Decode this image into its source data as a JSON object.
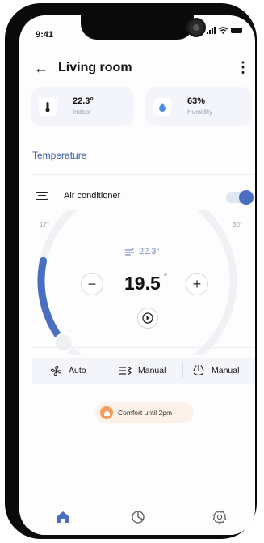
{
  "status": {
    "time": "9:41"
  },
  "header": {
    "title": "Living room"
  },
  "cards": {
    "indoor": {
      "value": "22.3°",
      "label": "Indoor"
    },
    "humidity": {
      "value": "63%",
      "label": "Humidity"
    }
  },
  "section": {
    "title": "Temperature"
  },
  "ac": {
    "label": "Air conditioner",
    "on": true
  },
  "dial": {
    "min_label": "17°",
    "max_label": "30°",
    "current": "22.3°",
    "setpoint": "19.5",
    "setpoint_unit": "°",
    "min_value": 17,
    "max_value": 30,
    "setpoint_value": 19.5
  },
  "modes": [
    {
      "icon": "fan-icon",
      "label": "Auto"
    },
    {
      "icon": "airflow-icon",
      "label": "Manual"
    },
    {
      "icon": "swing-icon",
      "label": "Manual"
    }
  ],
  "comfort": {
    "label": "Comfort until 2pm"
  },
  "colors": {
    "accent": "#4a6fc1",
    "orange": "#f29c5e",
    "section": "#3b5ca8"
  },
  "nav": [
    "home-icon",
    "stats-icon",
    "settings-icon"
  ]
}
